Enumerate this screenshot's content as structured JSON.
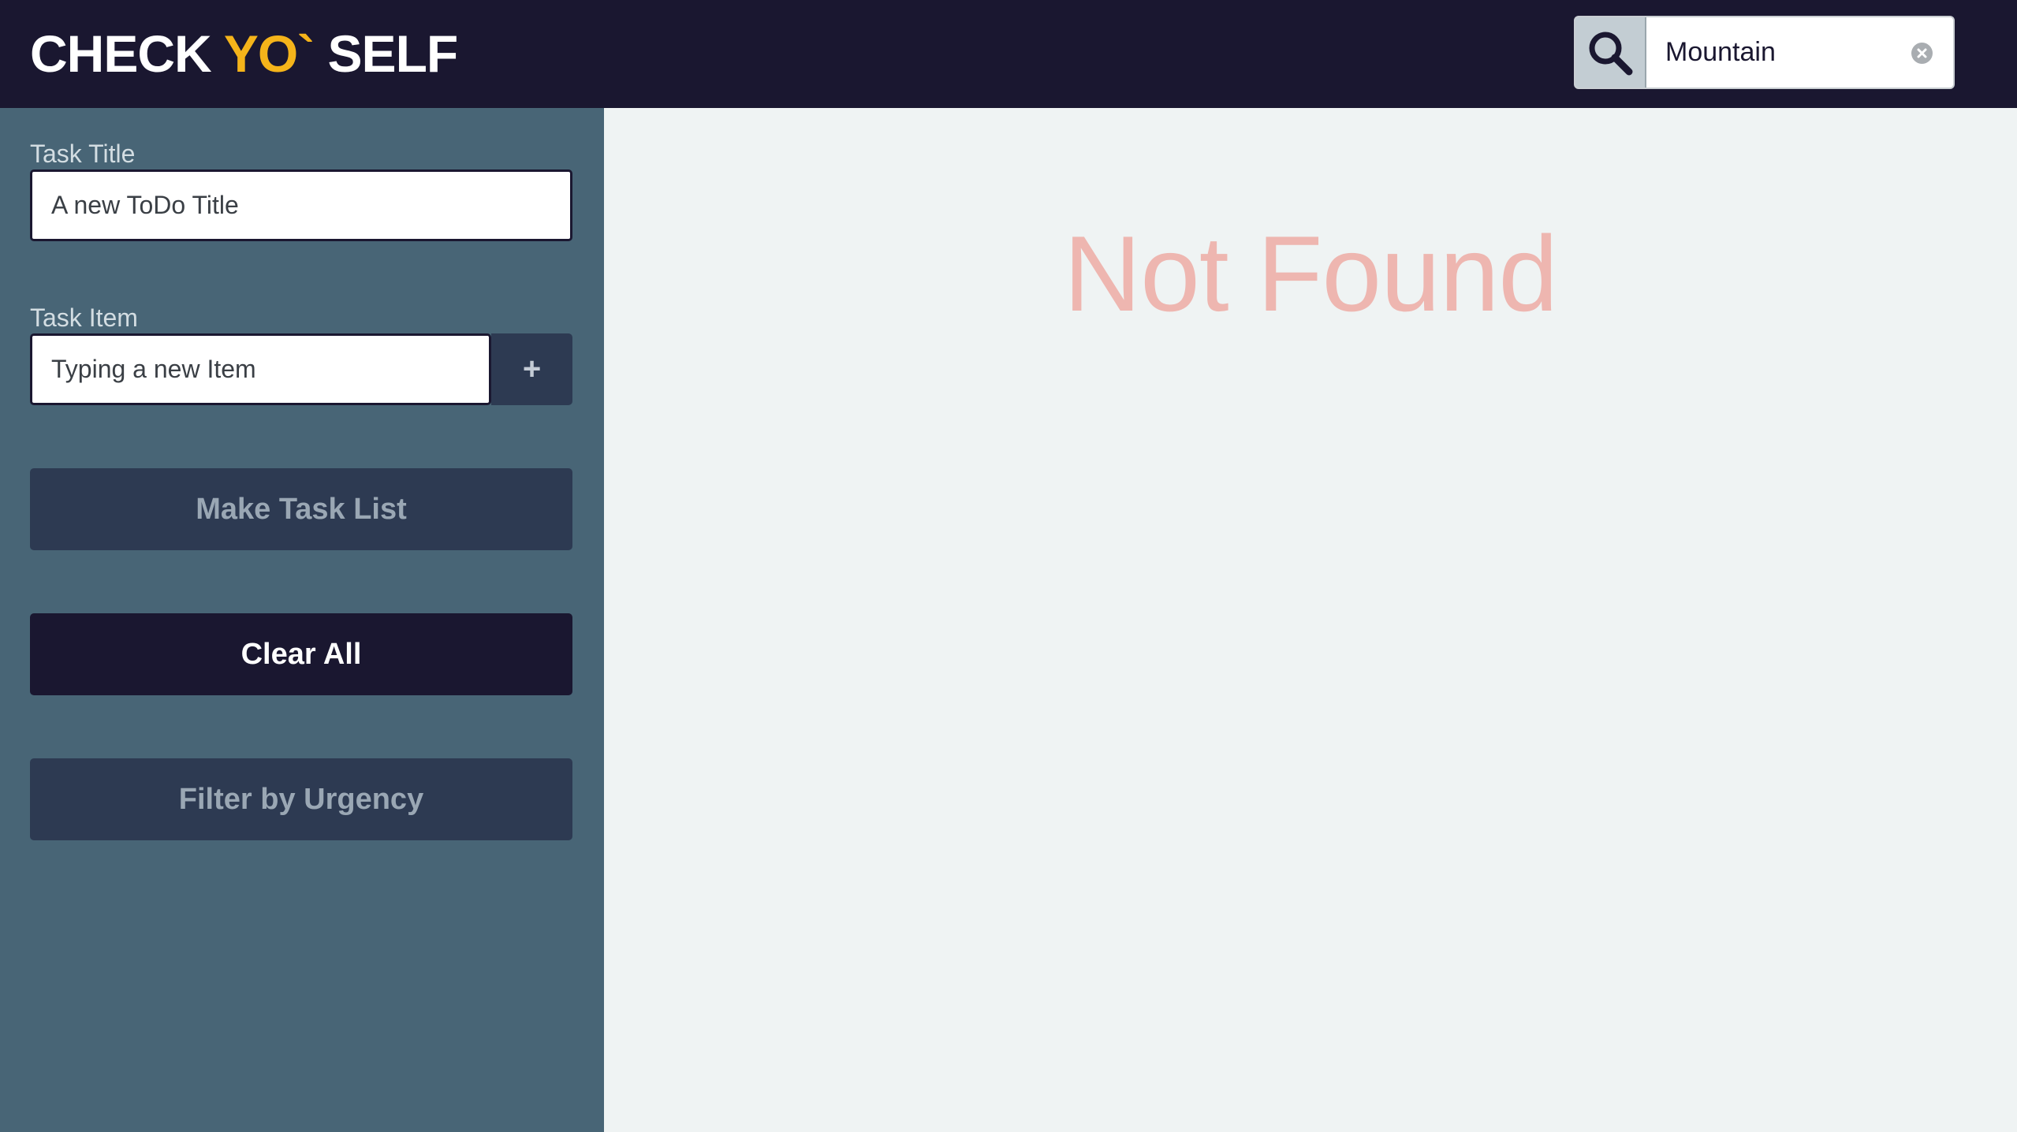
{
  "header": {
    "logo_part1": "CHECK",
    "logo_part2": "YO`",
    "logo_part3": "SELF",
    "accent_color": "#f5b41a"
  },
  "search": {
    "icon": "search-icon",
    "value": "Mountain",
    "clear_icon": "clear-circle-icon"
  },
  "sidebar": {
    "task_title_label": "Task Title",
    "task_title_value": "A new ToDo Title",
    "task_item_label": "Task Item",
    "task_item_value": "Typing a new Item",
    "add_item_label": "+",
    "make_task_list_label": "Make Task List",
    "clear_all_label": "Clear All",
    "filter_label": "Filter by Urgency"
  },
  "main": {
    "message": "Not Found",
    "message_color": "#eeb6b0"
  }
}
